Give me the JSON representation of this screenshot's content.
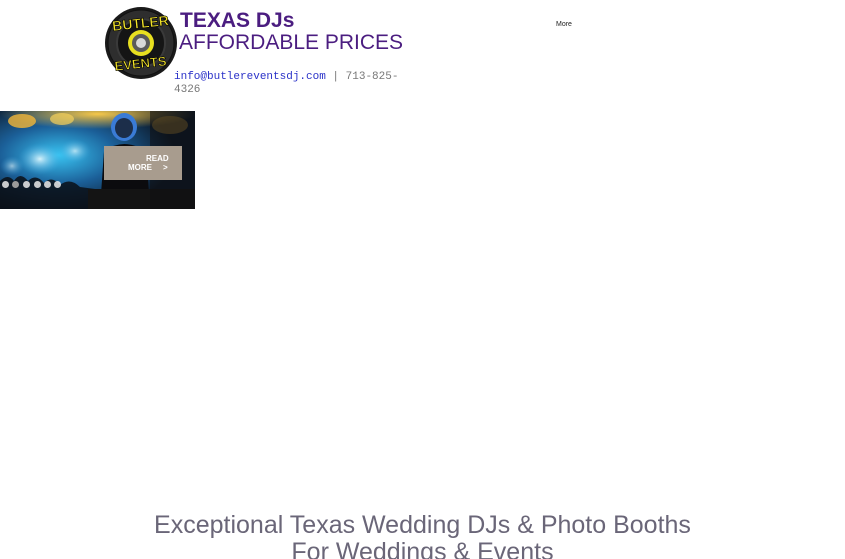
{
  "brand": {
    "logo_text_top": "BUTLER",
    "logo_text_bottom": "EVENTS",
    "title": "TEXAS DJs",
    "subtitle": "AFFORDABLE PRICES"
  },
  "contact": {
    "email": "info@butlereventsdj.com",
    "separator": " | ",
    "phone": "713-825-4326"
  },
  "nav": {
    "more_label": "More"
  },
  "slideshow": {
    "read_more_line1": "READ",
    "read_more_line2": "MORE",
    "read_more_arrow": ">",
    "dot_count": 6,
    "active_dot": 1
  },
  "headline": {
    "line1": "Exceptional Texas Wedding DJs & Photo Booths",
    "line2": "For Weddings & Events"
  },
  "colors": {
    "brand_purple": "#4b1d80",
    "email_blue": "#2a31c8",
    "headline_gray": "#6a6678",
    "button_taupe": "#a89c8e",
    "logo_yellow": "#f2e32a"
  }
}
